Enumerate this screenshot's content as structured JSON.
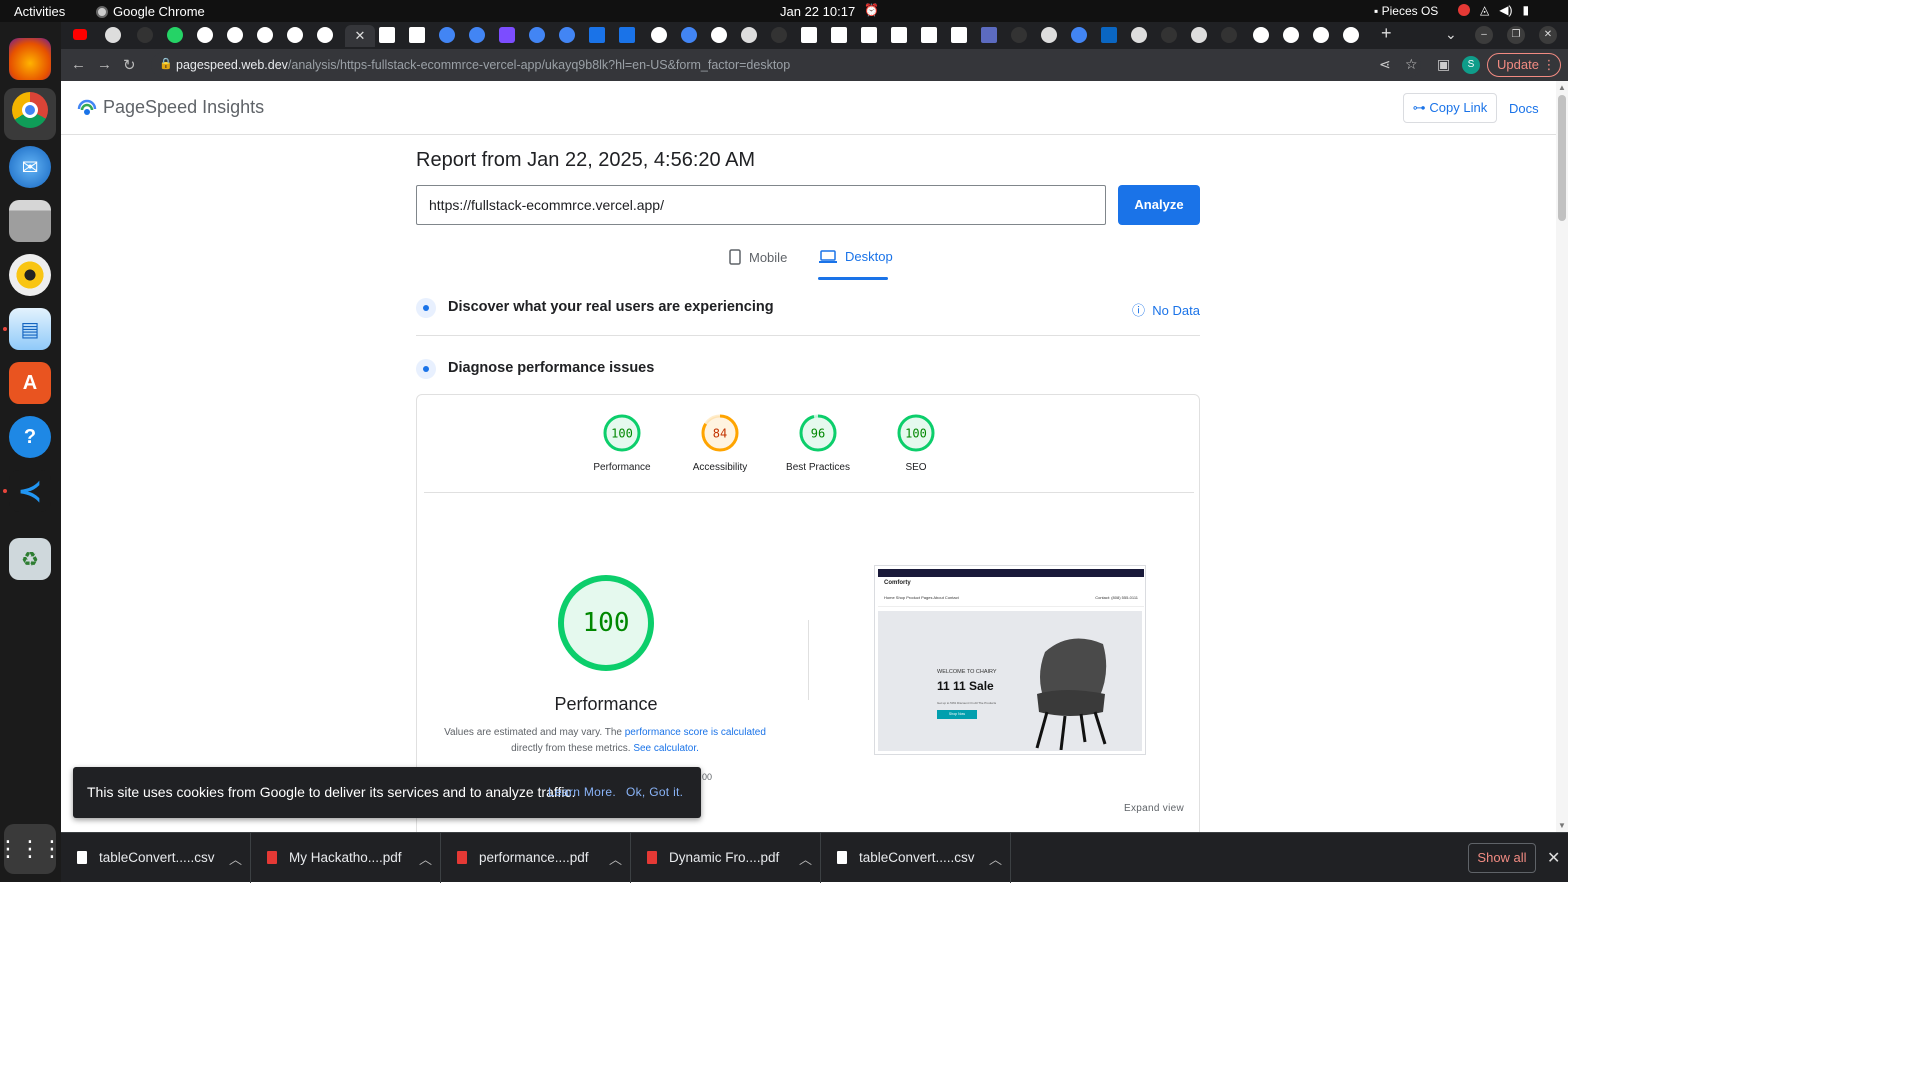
{
  "system": {
    "activities": "Activities",
    "app_name": "Google Chrome",
    "clock": "Jan 22  10:17",
    "pieces": "Pieces OS"
  },
  "browser": {
    "url_host": "pagespeed.web.dev",
    "url_path": "/analysis/https-fullstack-ecommrce-vercel-app/ukayq9b8lk?hl=en-US&form_factor=desktop",
    "profile_initial": "S",
    "update_label": "Update"
  },
  "psi": {
    "brand": "PageSpeed Insights",
    "copy_link": "Copy Link",
    "docs": "Docs",
    "report_title": "Report from Jan 22, 2025, 4:56:20 AM",
    "url_value": "https://fullstack-ecommrce.vercel.app/",
    "analyze": "Analyze",
    "tab_mobile": "Mobile",
    "tab_desktop": "Desktop",
    "discover_title": "Discover what your real users are experiencing",
    "no_data": "No Data",
    "diagnose_title": "Diagnose performance issues",
    "scores": [
      {
        "label": "Performance",
        "value": "100",
        "score": 100,
        "color": "#0cce6b",
        "text_color": "#008800"
      },
      {
        "label": "Accessibility",
        "value": "84",
        "score": 84,
        "color": "#ffa400",
        "text_color": "#c33300"
      },
      {
        "label": "Best Practices",
        "value": "96",
        "score": 96,
        "color": "#0cce6b",
        "text_color": "#008800"
      },
      {
        "label": "SEO",
        "value": "100",
        "score": 100,
        "color": "#0cce6b",
        "text_color": "#008800"
      }
    ],
    "big_score": "100",
    "big_label": "Performance",
    "note_1": "Values are estimated and may vary. The ",
    "note_link_1": "performance score is calculated",
    "note_2": "directly from these metrics. ",
    "note_link_2": "See calculator.",
    "stray_text": "00",
    "expand_view": "Expand view"
  },
  "screenshot_thumb": {
    "top_bar_text": "Free Shipping On All Orders Over $50",
    "brand": "Comforty",
    "links": "Home   Shop   Product   Pages   About   Contact",
    "contact": "Contact: (808) 555-0111",
    "kicker": "WELCOME TO CHAIRY",
    "sale": "11 11 Sale",
    "sub": "Get up to 50% Discount On All The Products",
    "button": "Shop Now"
  },
  "cookie": {
    "message": "This site uses cookies from Google to deliver its services and to analyze traffic.",
    "learn_more": "Learn More.",
    "ok": "Ok, Got it."
  },
  "downloads": [
    {
      "name": "tableConvert.....csv",
      "type": "csv"
    },
    {
      "name": "My Hackatho....pdf",
      "type": "pdf"
    },
    {
      "name": "performance....pdf",
      "type": "pdf"
    },
    {
      "name": "Dynamic Fro....pdf",
      "type": "pdf"
    },
    {
      "name": "tableConvert.....csv",
      "type": "csv"
    }
  ],
  "show_all": "Show all",
  "colors": {
    "accent": "#1a73e8",
    "pass": "#0cce6b",
    "average": "#ffa400"
  }
}
